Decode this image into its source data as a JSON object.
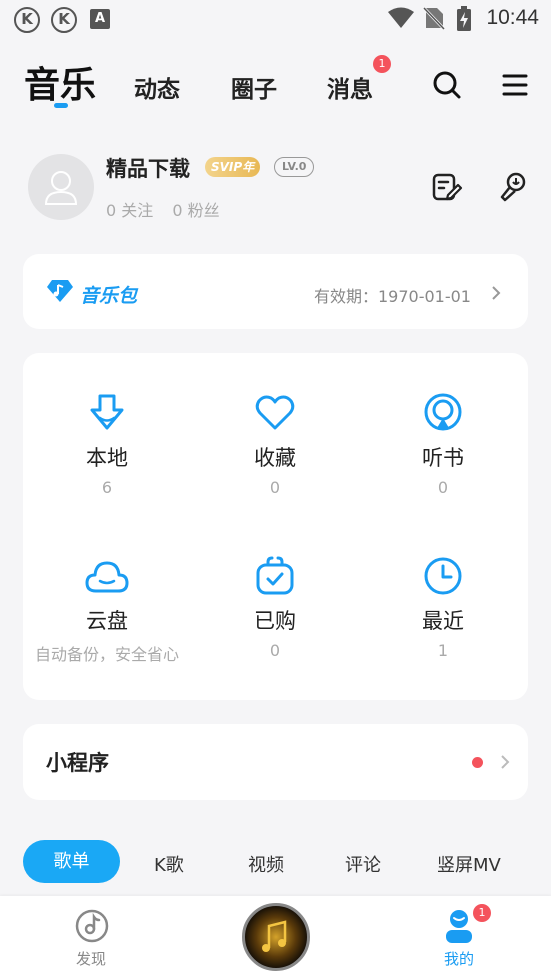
{
  "status_bar": {
    "left_icons": [
      "K",
      "K",
      "A"
    ],
    "time": "10:44"
  },
  "header": {
    "tabs": [
      {
        "label": "音乐",
        "active": true
      },
      {
        "label": "动态"
      },
      {
        "label": "圈子"
      },
      {
        "label": "消息",
        "badge": "1"
      }
    ],
    "icons": [
      "search-icon",
      "menu-icon"
    ]
  },
  "profile": {
    "name": "精品下载",
    "svip_badge": "SVIP年",
    "level_badge": "LV.0",
    "following": "0 关注",
    "followers": "0 粉丝",
    "icons": [
      "edit-icon",
      "microphone-icon"
    ]
  },
  "music_pack": {
    "title": "音乐包",
    "validity": "有效期：1970-01-01"
  },
  "grid": [
    {
      "label": "本地",
      "count": "6",
      "icon": "download-icon"
    },
    {
      "label": "收藏",
      "count": "0",
      "icon": "heart-icon"
    },
    {
      "label": "听书",
      "count": "0",
      "icon": "audiobook-icon"
    },
    {
      "label": "云盘",
      "count": "自动备份，安全省心",
      "icon": "cloud-icon"
    },
    {
      "label": "已购",
      "count": "0",
      "icon": "purchased-bag-icon"
    },
    {
      "label": "最近",
      "count": "1",
      "icon": "clock-icon"
    }
  ],
  "mini_programs": {
    "label": "小程序"
  },
  "category_tabs": [
    {
      "label": "歌单",
      "active": true
    },
    {
      "label": "K歌"
    },
    {
      "label": "视频"
    },
    {
      "label": "评论"
    },
    {
      "label": "竖屏MV"
    }
  ],
  "bottom_nav": {
    "discover": "发现",
    "mine": "我的",
    "mine_badge": "1"
  },
  "colors": {
    "accent": "#1a9cf2",
    "badge": "#f4535c",
    "background": "#f5f5f7"
  }
}
